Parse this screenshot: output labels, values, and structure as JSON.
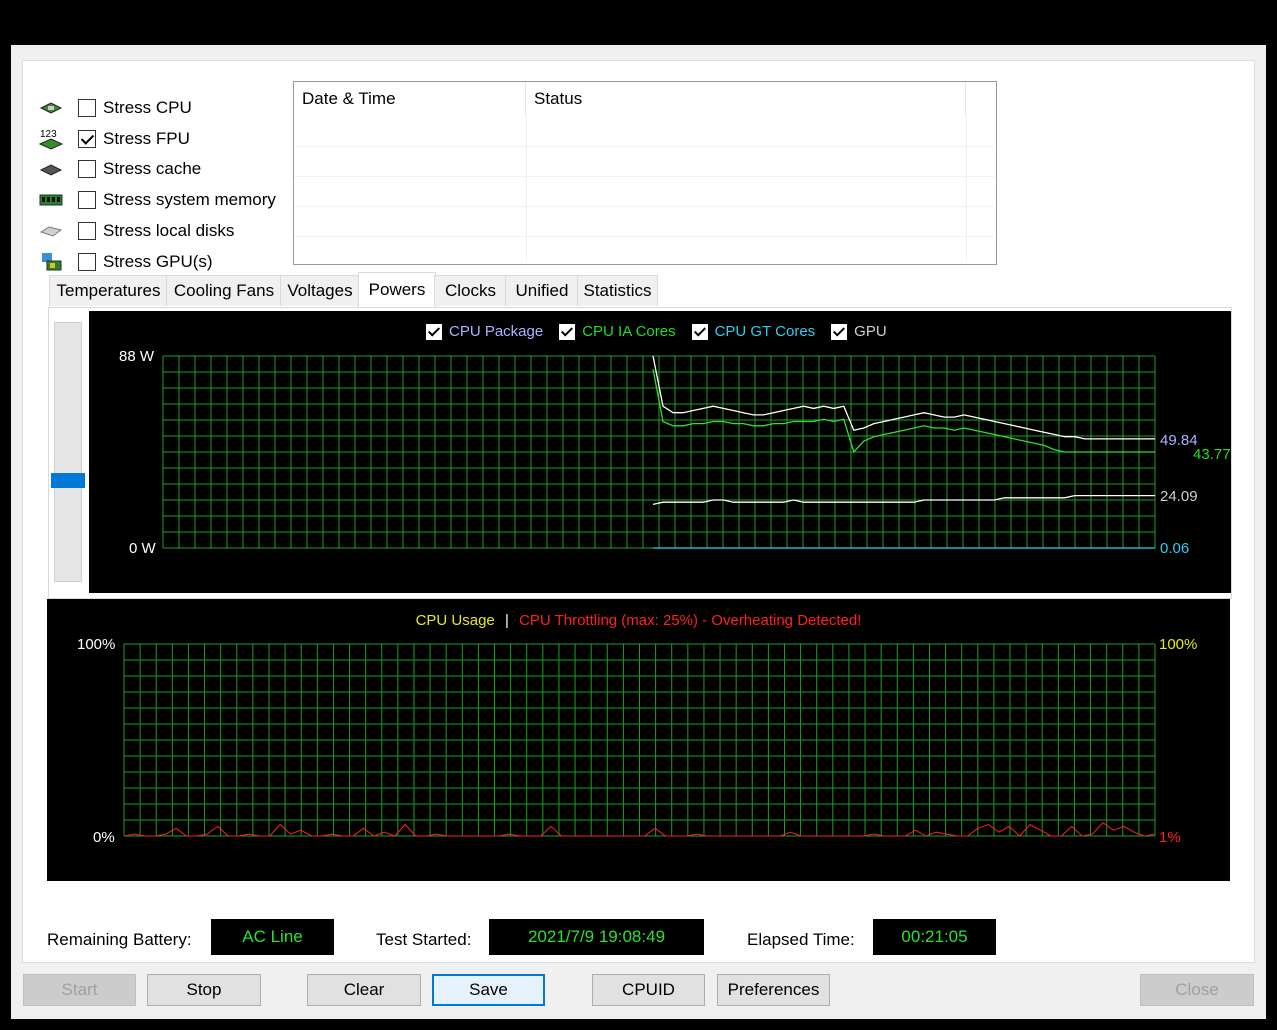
{
  "stress_options": [
    {
      "label": "Stress CPU",
      "checked": false,
      "icon": "cpu-chip-icon"
    },
    {
      "label": "Stress FPU",
      "checked": true,
      "icon": "fpu-chip-icon"
    },
    {
      "label": "Stress cache",
      "checked": false,
      "icon": "cache-chip-icon"
    },
    {
      "label": "Stress system memory",
      "checked": false,
      "icon": "memory-module-icon"
    },
    {
      "label": "Stress local disks",
      "checked": false,
      "icon": "disk-drive-icon"
    },
    {
      "label": "Stress GPU(s)",
      "checked": false,
      "icon": "gpu-card-icon"
    }
  ],
  "fpu_icon_text": "123",
  "log": {
    "col_datetime": "Date & Time",
    "col_status": "Status"
  },
  "tabs": [
    "Temperatures",
    "Cooling Fans",
    "Voltages",
    "Powers",
    "Clocks",
    "Unified",
    "Statistics"
  ],
  "active_tab": "Powers",
  "power_chart": {
    "legend": [
      {
        "label": "CPU Package",
        "color": "#aab4ff"
      },
      {
        "label": "CPU IA Cores",
        "color": "#22dd22"
      },
      {
        "label": "CPU GT Cores",
        "color": "#33ccee"
      },
      {
        "label": "GPU",
        "color": "#d0d0d0"
      }
    ],
    "y_max_label": "88 W",
    "y_min_label": "0 W",
    "readouts": [
      {
        "value": "49.84",
        "color": "#aab4ff"
      },
      {
        "value": "43.77",
        "color": "#22dd22"
      },
      {
        "value": "24.09",
        "color": "#d0d0d0"
      },
      {
        "value": "0.06",
        "color": "#33ccee"
      }
    ]
  },
  "usage_chart": {
    "title_usage": "CPU Usage",
    "separator": "|",
    "title_throttle": "CPU Throttling (max: 25%) - Overheating Detected!",
    "left_max": "100%",
    "left_min": "0%",
    "right_max": "100%",
    "right_min": "1%",
    "usage_color": "#e8e820",
    "throttle_color": "#ff2020"
  },
  "chart_data": [
    {
      "type": "line",
      "ylim": [
        0,
        88
      ],
      "series": [
        {
          "name": "CPU Package",
          "color": "#ffffff",
          "values": [
            88,
            65,
            62,
            62,
            63,
            64,
            65,
            64,
            63,
            62,
            61,
            61,
            62,
            63,
            64,
            65,
            64,
            65,
            64,
            65,
            54,
            55,
            57,
            58,
            59,
            60,
            61,
            62,
            61,
            60,
            60,
            61,
            60,
            59,
            58,
            57,
            56,
            55,
            54,
            53,
            52,
            51,
            51,
            50,
            50,
            50,
            50,
            50,
            50,
            50,
            50
          ]
        },
        {
          "name": "CPU IA Cores",
          "color": "#33dd33",
          "values": [
            82,
            58,
            56,
            56,
            57,
            57,
            58,
            58,
            57,
            57,
            56,
            56,
            57,
            57,
            58,
            58,
            58,
            59,
            58,
            59,
            44,
            49,
            51,
            52,
            53,
            54,
            55,
            56,
            55,
            55,
            54,
            55,
            54,
            53,
            52,
            51,
            50,
            49,
            48,
            47,
            45,
            44,
            44,
            44,
            44,
            44,
            44,
            44,
            44,
            44,
            44
          ]
        },
        {
          "name": "GPU",
          "color": "#ffffff",
          "values": [
            20,
            21,
            21,
            21,
            21,
            21,
            22,
            22,
            21,
            21,
            21,
            21,
            21,
            21,
            22,
            21,
            21,
            21,
            21,
            21,
            21,
            21,
            21,
            21,
            21,
            21,
            21,
            22,
            22,
            22,
            22,
            22,
            22,
            22,
            22,
            23,
            23,
            23,
            23,
            23,
            23,
            23,
            24,
            24,
            24,
            24,
            24,
            24,
            24,
            24,
            24
          ]
        },
        {
          "name": "CPU GT Cores",
          "color": "#33ccee",
          "values": [
            0,
            0,
            0,
            0,
            0,
            0,
            0,
            0,
            0,
            0,
            0,
            0,
            0,
            0,
            0,
            0,
            0,
            0,
            0,
            0,
            0,
            0,
            0,
            0,
            0,
            0,
            0,
            0,
            0,
            0,
            0,
            0,
            0,
            0,
            0,
            0,
            0,
            0,
            0,
            0,
            0,
            0,
            0,
            0,
            0,
            0,
            0,
            0,
            0,
            0,
            0
          ]
        }
      ]
    },
    {
      "type": "line",
      "ylim": [
        0,
        100
      ],
      "series": [
        {
          "name": "CPU Throttling",
          "color": "#ff2020",
          "values": [
            0,
            1,
            0,
            0,
            1,
            4,
            0,
            0,
            1,
            5,
            0,
            0,
            1,
            0,
            0,
            6,
            1,
            3,
            0,
            0,
            1,
            0,
            0,
            4,
            0,
            2,
            0,
            6,
            0,
            0,
            1,
            0,
            0,
            0,
            0,
            0,
            0,
            1,
            0,
            0,
            0,
            5,
            0,
            0,
            0,
            0,
            0,
            0,
            0,
            0,
            0,
            4,
            0,
            0,
            0,
            1,
            0,
            0,
            0,
            0,
            0,
            0,
            0,
            0,
            2,
            0,
            0,
            0,
            0,
            0,
            0,
            0,
            1,
            0,
            0,
            0,
            3,
            0,
            2,
            1,
            0,
            0,
            4,
            6,
            2,
            5,
            0,
            6,
            3,
            0,
            0,
            5,
            0,
            1,
            7,
            3,
            5,
            2,
            0,
            1
          ]
        }
      ]
    }
  ],
  "status_bar": {
    "battery_label": "Remaining Battery:",
    "battery_value": "AC Line",
    "started_label": "Test Started:",
    "started_value": "2021/7/9 19:08:49",
    "elapsed_label": "Elapsed Time:",
    "elapsed_value": "00:21:05"
  },
  "buttons": {
    "start": "Start",
    "stop": "Stop",
    "clear": "Clear",
    "save": "Save",
    "cpuid": "CPUID",
    "preferences": "Preferences",
    "close": "Close"
  }
}
